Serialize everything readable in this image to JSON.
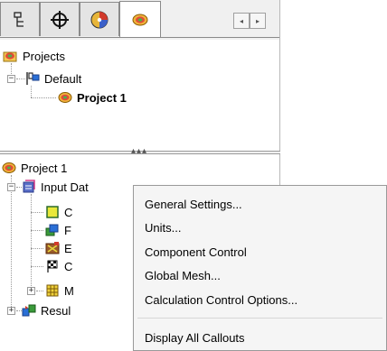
{
  "tabs": [
    {
      "name": "tree-icon"
    },
    {
      "name": "crosshair-icon"
    },
    {
      "name": "results-sphere-icon"
    },
    {
      "name": "projects-icon",
      "active": true
    }
  ],
  "top_tree": {
    "root_label": "Projects",
    "group_label": "Default",
    "project_label": "Project 1"
  },
  "bottom_tree": {
    "root_label": "Project 1",
    "input_label": "Input Dat",
    "children_partial": [
      "C",
      "F",
      "E",
      "C",
      "M"
    ],
    "results_label": "Resul"
  },
  "context_menu": {
    "items": [
      "General Settings...",
      "Units...",
      "Component Control",
      "Global Mesh...",
      "Calculation Control Options..."
    ],
    "after_separator": "Display All Callouts"
  },
  "scroll_buttons": {
    "left": "◂",
    "right": "▸"
  }
}
